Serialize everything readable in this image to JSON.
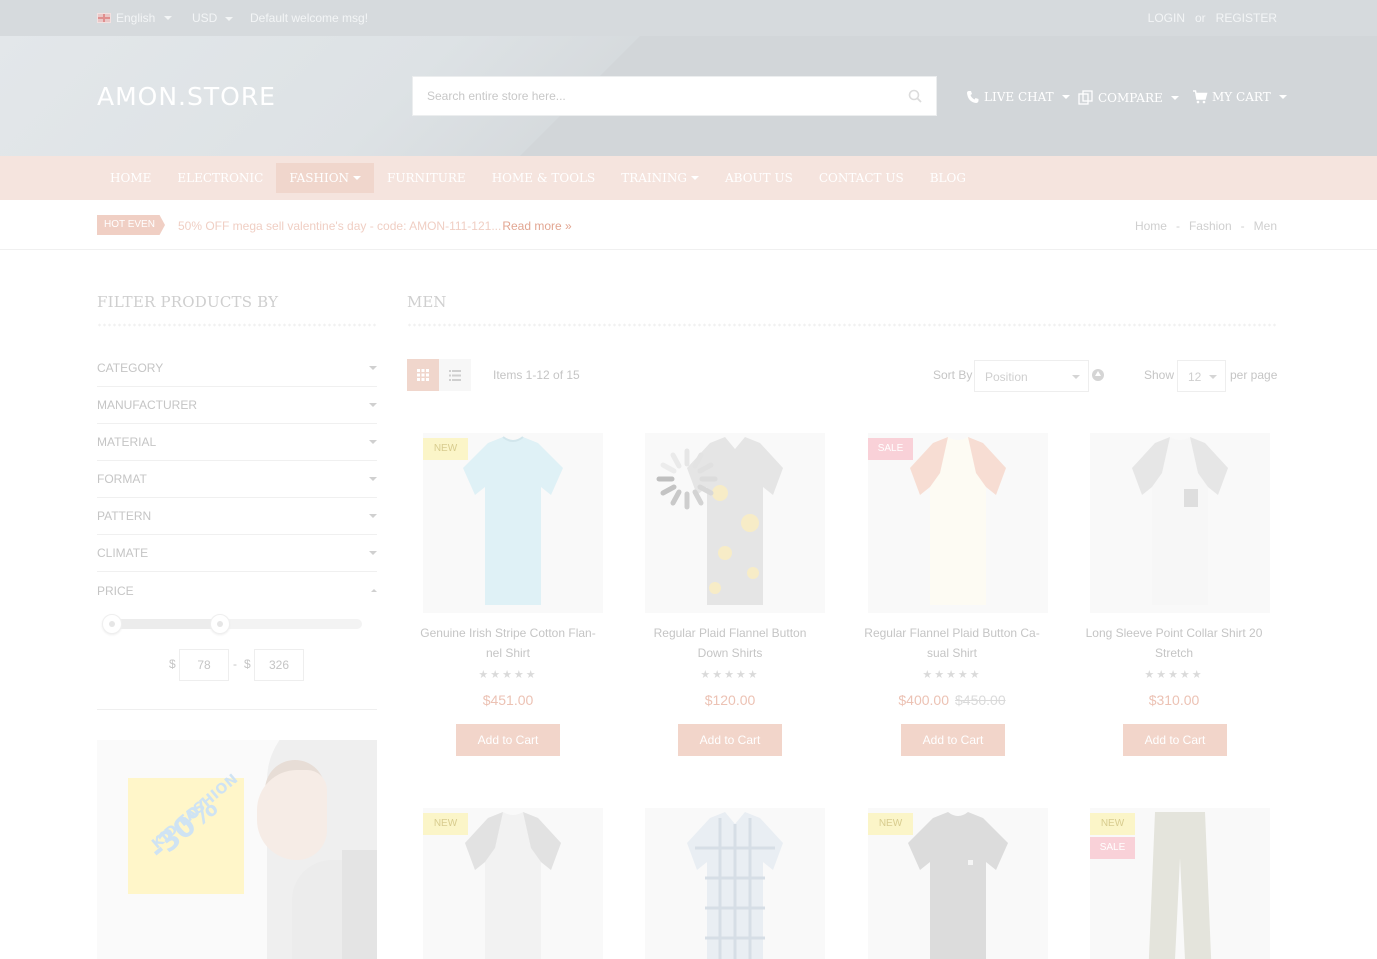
{
  "topbar": {
    "language": "English",
    "currency": "USD",
    "welcome": "Default welcome msg!",
    "login": "LOGIN",
    "or": "or",
    "register": "REGISTER"
  },
  "header": {
    "logo": "AMON.STORE",
    "search_placeholder": "Search entire store here...",
    "live_chat": "LIVE CHAT",
    "compare": "COMPARE",
    "cart": "MY CART"
  },
  "nav": {
    "items": [
      "HOME",
      "ELECTRONIC",
      "FASHION",
      "FURNITURE",
      "HOME & TOOLS",
      "TRAINING",
      "ABOUT US",
      "CONTACT US",
      "BLOG"
    ]
  },
  "hot": {
    "label": "HOT EVEN",
    "text": "50% OFF mega sell valentine's day - code: AMON-111-121...",
    "more": "Read more »"
  },
  "breadcrumb": {
    "home": "Home",
    "sep": "-",
    "fashion": "Fashion",
    "current": "Men"
  },
  "sidebar": {
    "title": "FILTER PRODUCTS BY",
    "filters": [
      "CATEGORY",
      "MANUFACTURER",
      "MATERIAL",
      "FORMAT",
      "PATTERN",
      "CLIMATE",
      "PRICE"
    ],
    "price_currency": "$",
    "price_min": "78",
    "price_sep": "-",
    "price_max": "326",
    "banner_pct": "-30%",
    "banner_text": "KID FASHION"
  },
  "main": {
    "title": "MEN",
    "items_text": "Items 1-12 of 15",
    "sort_label": "Sort By",
    "sort_value": "Position",
    "show_label": "Show",
    "show_value": "12",
    "per_page": "per page",
    "add_to_cart": "Add to Cart",
    "badge_new": "NEW",
    "badge_sale": "SALE",
    "stars": "★★★★★"
  },
  "products": [
    {
      "name_1": "Genuine Irish Stripe Cotton Flan-",
      "name_2": "nel Shirt",
      "price": "$451.00",
      "old": ""
    },
    {
      "name_1": "Regular Plaid Flannel Button",
      "name_2": "Down Shirts",
      "price": "$120.00",
      "old": ""
    },
    {
      "name_1": "Regular Flannel Plaid Button Ca-",
      "name_2": "sual Shirt",
      "price": "$400.00",
      "old": "$450.00"
    },
    {
      "name_1": "Long Sleeve Point Collar Shirt 20",
      "name_2": "Stretch",
      "price": "$310.00",
      "old": ""
    }
  ],
  "colors": {
    "accent": "#f2d5ca",
    "price": "#ecc2b4",
    "topbar": "#d6dadd",
    "nav": "#f5e4de"
  }
}
